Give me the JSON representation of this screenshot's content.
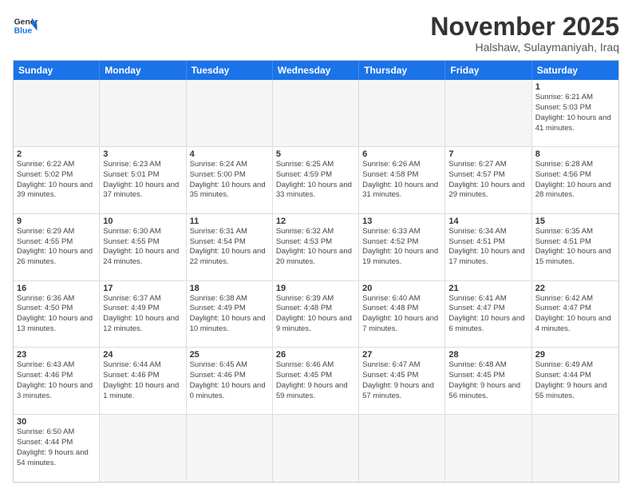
{
  "header": {
    "logo_general": "General",
    "logo_blue": "Blue",
    "month_title": "November 2025",
    "subtitle": "Halshaw, Sulaymaniyah, Iraq"
  },
  "weekdays": [
    "Sunday",
    "Monday",
    "Tuesday",
    "Wednesday",
    "Thursday",
    "Friday",
    "Saturday"
  ],
  "cells": [
    {
      "day": "",
      "info": "",
      "empty": true
    },
    {
      "day": "",
      "info": "",
      "empty": true
    },
    {
      "day": "",
      "info": "",
      "empty": true
    },
    {
      "day": "",
      "info": "",
      "empty": true
    },
    {
      "day": "",
      "info": "",
      "empty": true
    },
    {
      "day": "",
      "info": "",
      "empty": true
    },
    {
      "day": "1",
      "info": "Sunrise: 6:21 AM\nSunset: 5:03 PM\nDaylight: 10 hours and 41 minutes.",
      "empty": false
    },
    {
      "day": "2",
      "info": "Sunrise: 6:22 AM\nSunset: 5:02 PM\nDaylight: 10 hours and 39 minutes.",
      "empty": false
    },
    {
      "day": "3",
      "info": "Sunrise: 6:23 AM\nSunset: 5:01 PM\nDaylight: 10 hours and 37 minutes.",
      "empty": false
    },
    {
      "day": "4",
      "info": "Sunrise: 6:24 AM\nSunset: 5:00 PM\nDaylight: 10 hours and 35 minutes.",
      "empty": false
    },
    {
      "day": "5",
      "info": "Sunrise: 6:25 AM\nSunset: 4:59 PM\nDaylight: 10 hours and 33 minutes.",
      "empty": false
    },
    {
      "day": "6",
      "info": "Sunrise: 6:26 AM\nSunset: 4:58 PM\nDaylight: 10 hours and 31 minutes.",
      "empty": false
    },
    {
      "day": "7",
      "info": "Sunrise: 6:27 AM\nSunset: 4:57 PM\nDaylight: 10 hours and 29 minutes.",
      "empty": false
    },
    {
      "day": "8",
      "info": "Sunrise: 6:28 AM\nSunset: 4:56 PM\nDaylight: 10 hours and 28 minutes.",
      "empty": false
    },
    {
      "day": "9",
      "info": "Sunrise: 6:29 AM\nSunset: 4:55 PM\nDaylight: 10 hours and 26 minutes.",
      "empty": false
    },
    {
      "day": "10",
      "info": "Sunrise: 6:30 AM\nSunset: 4:55 PM\nDaylight: 10 hours and 24 minutes.",
      "empty": false
    },
    {
      "day": "11",
      "info": "Sunrise: 6:31 AM\nSunset: 4:54 PM\nDaylight: 10 hours and 22 minutes.",
      "empty": false
    },
    {
      "day": "12",
      "info": "Sunrise: 6:32 AM\nSunset: 4:53 PM\nDaylight: 10 hours and 20 minutes.",
      "empty": false
    },
    {
      "day": "13",
      "info": "Sunrise: 6:33 AM\nSunset: 4:52 PM\nDaylight: 10 hours and 19 minutes.",
      "empty": false
    },
    {
      "day": "14",
      "info": "Sunrise: 6:34 AM\nSunset: 4:51 PM\nDaylight: 10 hours and 17 minutes.",
      "empty": false
    },
    {
      "day": "15",
      "info": "Sunrise: 6:35 AM\nSunset: 4:51 PM\nDaylight: 10 hours and 15 minutes.",
      "empty": false
    },
    {
      "day": "16",
      "info": "Sunrise: 6:36 AM\nSunset: 4:50 PM\nDaylight: 10 hours and 13 minutes.",
      "empty": false
    },
    {
      "day": "17",
      "info": "Sunrise: 6:37 AM\nSunset: 4:49 PM\nDaylight: 10 hours and 12 minutes.",
      "empty": false
    },
    {
      "day": "18",
      "info": "Sunrise: 6:38 AM\nSunset: 4:49 PM\nDaylight: 10 hours and 10 minutes.",
      "empty": false
    },
    {
      "day": "19",
      "info": "Sunrise: 6:39 AM\nSunset: 4:48 PM\nDaylight: 10 hours and 9 minutes.",
      "empty": false
    },
    {
      "day": "20",
      "info": "Sunrise: 6:40 AM\nSunset: 4:48 PM\nDaylight: 10 hours and 7 minutes.",
      "empty": false
    },
    {
      "day": "21",
      "info": "Sunrise: 6:41 AM\nSunset: 4:47 PM\nDaylight: 10 hours and 6 minutes.",
      "empty": false
    },
    {
      "day": "22",
      "info": "Sunrise: 6:42 AM\nSunset: 4:47 PM\nDaylight: 10 hours and 4 minutes.",
      "empty": false
    },
    {
      "day": "23",
      "info": "Sunrise: 6:43 AM\nSunset: 4:46 PM\nDaylight: 10 hours and 3 minutes.",
      "empty": false
    },
    {
      "day": "24",
      "info": "Sunrise: 6:44 AM\nSunset: 4:46 PM\nDaylight: 10 hours and 1 minute.",
      "empty": false
    },
    {
      "day": "25",
      "info": "Sunrise: 6:45 AM\nSunset: 4:46 PM\nDaylight: 10 hours and 0 minutes.",
      "empty": false
    },
    {
      "day": "26",
      "info": "Sunrise: 6:46 AM\nSunset: 4:45 PM\nDaylight: 9 hours and 59 minutes.",
      "empty": false
    },
    {
      "day": "27",
      "info": "Sunrise: 6:47 AM\nSunset: 4:45 PM\nDaylight: 9 hours and 57 minutes.",
      "empty": false
    },
    {
      "day": "28",
      "info": "Sunrise: 6:48 AM\nSunset: 4:45 PM\nDaylight: 9 hours and 56 minutes.",
      "empty": false
    },
    {
      "day": "29",
      "info": "Sunrise: 6:49 AM\nSunset: 4:44 PM\nDaylight: 9 hours and 55 minutes.",
      "empty": false
    },
    {
      "day": "30",
      "info": "Sunrise: 6:50 AM\nSunset: 4:44 PM\nDaylight: 9 hours and 54 minutes.",
      "empty": false
    },
    {
      "day": "",
      "info": "",
      "empty": true
    },
    {
      "day": "",
      "info": "",
      "empty": true
    },
    {
      "day": "",
      "info": "",
      "empty": true
    },
    {
      "day": "",
      "info": "",
      "empty": true
    },
    {
      "day": "",
      "info": "",
      "empty": true
    },
    {
      "day": "",
      "info": "",
      "empty": true
    }
  ]
}
